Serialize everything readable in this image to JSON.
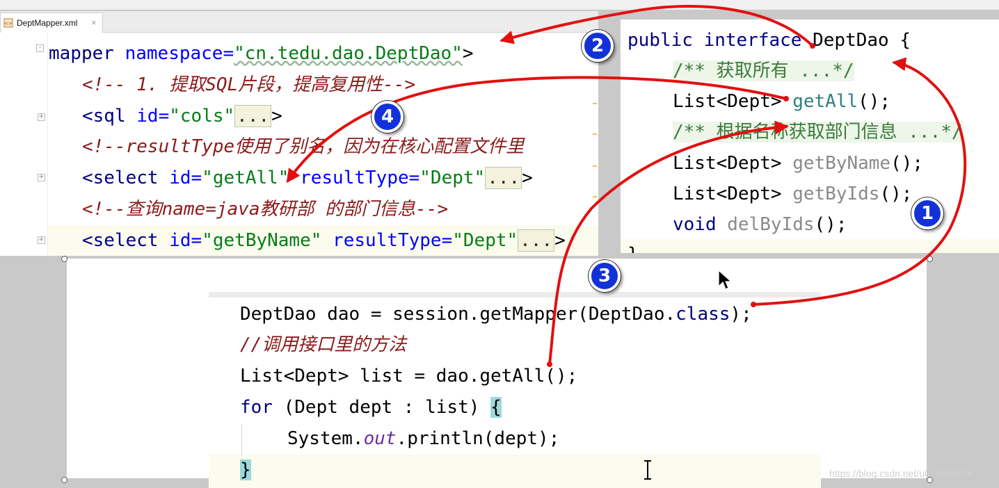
{
  "xml_editor": {
    "tab_label": "DeptMapper.xml",
    "lines": [
      {
        "a": "mapper",
        "b": " namespace=",
        "c": "\"cn.tedu.dao.DeptDao\"",
        "d": ">"
      },
      {
        "comment": "<!-- 1. 提取SQL片段，提高复用性-->"
      },
      {
        "a": "<sql",
        "b": " id=",
        "c": "\"cols\"",
        "fold": "...",
        "d": ">"
      },
      {
        "comment": "<!--resultType使用了别名，因为在核心配置文件里"
      },
      {
        "a": "<select",
        "b": " id=",
        "c": "\"getAll\"",
        "b2": " resultType=",
        "c2": "\"Dept\"",
        "fold": "...",
        "d": ">"
      },
      {
        "comment": "<!--查询name=java教研部 的部门信息-->"
      },
      {
        "a": "<select",
        "b": " id=",
        "c": "\"getByName\"",
        "b2": " resultType=",
        "c2": "\"Dept\"",
        "fold": "...",
        "d": ">"
      }
    ]
  },
  "java_interface": {
    "line1_kw": "public interface",
    "line1_name": " DeptDao {",
    "doc1": "/** 获取所有 ...*/",
    "m1_type": "List<Dept>",
    "m1_name": "getAll",
    "m1_tail": "();",
    "doc2": "/** 根据名称获取部门信息 ...*/",
    "m2_type": "List<Dept>",
    "m2_name": "getByName",
    "m2_tail": "();",
    "m3_type": "List<Dept>",
    "m3_name": "getByIds",
    "m3_tail": "();",
    "m4_kw": "void",
    "m4_name": "delByIds",
    "m4_tail": "();",
    "close": "}"
  },
  "test_code": {
    "l1a": "DeptDao dao = session.getMapper(DeptDao.",
    "l1b": "class",
    "l1c": ");",
    "l2": "//调用接口里的方法",
    "l3": "List<Dept> list = dao.getAll();",
    "l4a": "for",
    "l4b": " (Dept dept : list) ",
    "l4c": "{",
    "l5a": "System.",
    "l5b": "out",
    "l5c": ".println(dept);",
    "l6": "}"
  },
  "badges": [
    "1",
    "2",
    "3",
    "4"
  ],
  "watermark": "https://blog.csdn.net/u012932876",
  "colors": {
    "annotation_arrow": "#e21010",
    "badge": "#1232d8"
  }
}
